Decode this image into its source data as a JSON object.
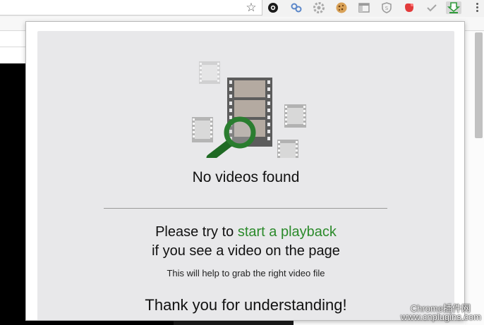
{
  "toolbar": {
    "bookmark_icon": "star-icon",
    "extensions": [
      {
        "name": "settings-gear-extension-icon",
        "color": "#1a1a1a"
      },
      {
        "name": "link-extension-icon",
        "color": "#5b87c9"
      },
      {
        "name": "gear-gray-extension-icon",
        "color": "#a9a9a9"
      },
      {
        "name": "cookie-extension-icon",
        "color": "#c98a3b"
      },
      {
        "name": "layout-extension-icon",
        "color": "#9a9a9a"
      },
      {
        "name": "shield-extension-icon",
        "color": "#9a9a9a"
      },
      {
        "name": "red-blob-extension-icon",
        "color": "#e23b3b"
      },
      {
        "name": "checkmark-extension-icon",
        "color": "#a5a5a5"
      },
      {
        "name": "video-downloader-extension-icon",
        "color": "#2f9a3a"
      }
    ],
    "menu_icon": "more-vertical-icon"
  },
  "popup": {
    "illustration": "no-videos-magnifier-illustration",
    "status_title": "No videos found",
    "try_prefix": "Please try to ",
    "try_link": "start a playback",
    "see_line": "if you see a video on the page",
    "hint": "This will help to grab the right video file",
    "thanks": "Thank you for understanding!",
    "link_color": "#2b8a2b"
  },
  "watermark": {
    "line1": "Chrome插件网",
    "line2": "www.cnplugins.com"
  }
}
